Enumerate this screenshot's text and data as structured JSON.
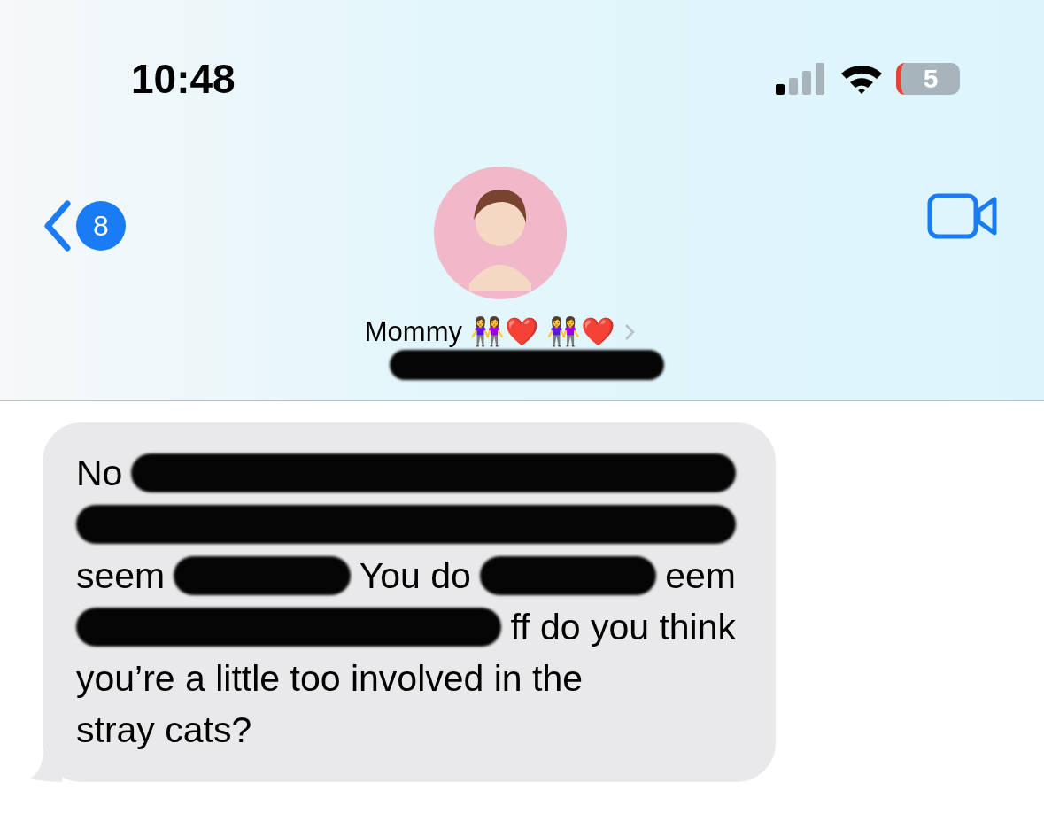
{
  "status_bar": {
    "time": "10:48",
    "battery_level": "5"
  },
  "nav": {
    "back_badge": "8",
    "contact_name": "Mommy 👭❤️ 👭❤️"
  },
  "message": {
    "lines": [
      [
        {
          "kind": "text",
          "text": "No"
        },
        {
          "kind": "redacted"
        }
      ],
      [
        {
          "kind": "redacted"
        }
      ],
      [
        {
          "kind": "text",
          "text": "seem"
        },
        {
          "kind": "redacted"
        },
        {
          "kind": "text",
          "text": "You do"
        },
        {
          "kind": "redacted"
        },
        {
          "kind": "text",
          "text": "eem"
        }
      ],
      [
        {
          "kind": "redacted"
        },
        {
          "kind": "text",
          "text": "ff do you think"
        }
      ],
      [
        {
          "kind": "text",
          "text": "you’re a little too involved in the"
        }
      ],
      [
        {
          "kind": "text",
          "text": "stray cats?"
        }
      ]
    ]
  }
}
